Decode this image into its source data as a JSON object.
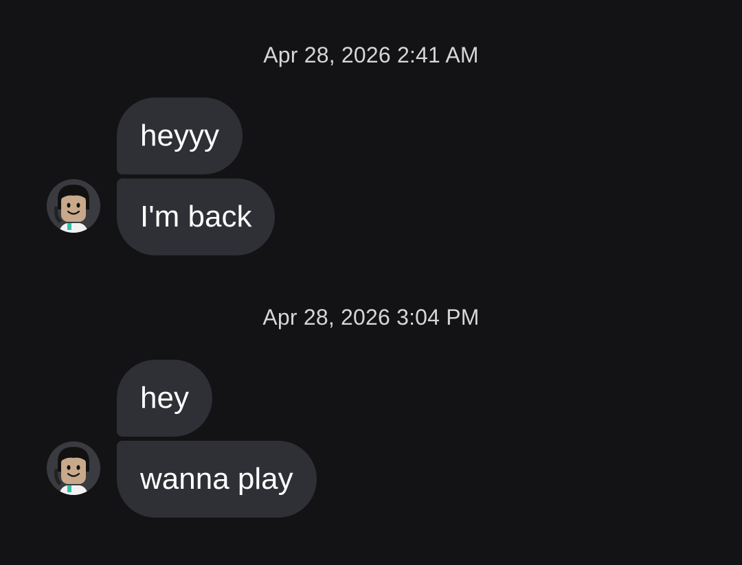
{
  "conversation": {
    "groups": [
      {
        "timestamp": "Apr 28, 2026 2:41 AM",
        "messages": [
          "heyyy",
          "I'm back"
        ]
      },
      {
        "timestamp": "Apr 28, 2026 3:04 PM",
        "messages": [
          "hey",
          "wanna play"
        ]
      }
    ]
  },
  "colors": {
    "background": "#131315",
    "bubble": "#2f3036",
    "timestamp_text": "#d6d6d8",
    "message_text": "#ffffff"
  },
  "icons": {
    "avatar": "user-avatar-icon"
  }
}
